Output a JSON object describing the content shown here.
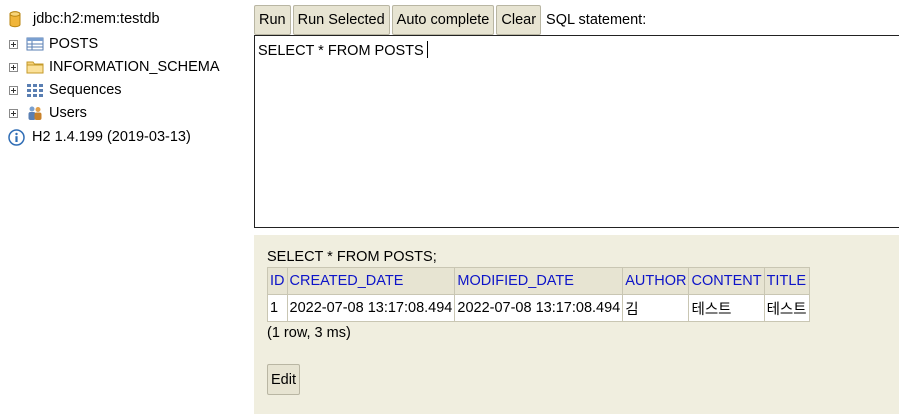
{
  "tree": {
    "connection": "jdbc:h2:mem:testdb",
    "items": [
      {
        "label": "POSTS",
        "icon": "table-icon"
      },
      {
        "label": "INFORMATION_SCHEMA",
        "icon": "folder-icon"
      },
      {
        "label": "Sequences",
        "icon": "sequences-icon"
      },
      {
        "label": "Users",
        "icon": "users-icon"
      }
    ],
    "version": "H2 1.4.199 (2019-03-13)"
  },
  "toolbar": {
    "run": "Run",
    "run_selected": "Run Selected",
    "auto_complete": "Auto complete",
    "clear": "Clear",
    "sql_label": "SQL statement:"
  },
  "editor": {
    "value": "SELECT * FROM POSTS"
  },
  "result": {
    "statement": "SELECT * FROM POSTS;",
    "columns": [
      "ID",
      "CREATED_DATE",
      "MODIFIED_DATE",
      "AUTHOR",
      "CONTENT",
      "TITLE"
    ],
    "rows": [
      [
        "1",
        "2022-07-08 13:17:08.494",
        "2022-07-08 13:17:08.494",
        "김",
        "테스트",
        "테스트"
      ]
    ],
    "summary": "(1 row, 3 ms)",
    "edit": "Edit"
  },
  "colors": {
    "result_bg": "#f0eedf",
    "button_bg": "#e7e4d2",
    "header_text": "#0d14c8"
  }
}
